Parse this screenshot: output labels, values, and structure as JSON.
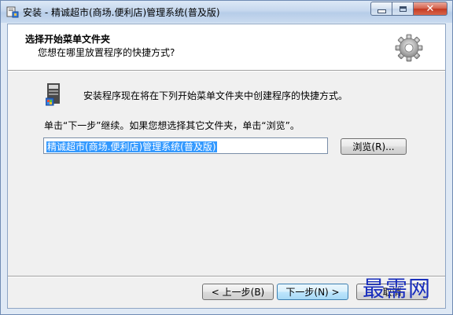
{
  "window": {
    "title": "安装 - 精诚超市(商场.便利店)管理系统(普及版)"
  },
  "header": {
    "title": "选择开始菜单文件夹",
    "subtitle": "您想在哪里放置程序的快捷方式?"
  },
  "body": {
    "info_text": "安装程序现在将在下列开始菜单文件夹中创建程序的快捷方式。",
    "instruction_text": "单击“下一步”继续。如果您想选择其它文件夹，单击“浏览”。",
    "folder_value": "精诚超市(商场.便利店)管理系统(普及版)",
    "browse_label": "浏览(R)..."
  },
  "footer": {
    "back_label": "< 上一步(B)",
    "next_label": "下一步(N) >",
    "cancel_label": "取消"
  },
  "watermark": "最需网",
  "icons": {
    "app": "installer-icon",
    "header": "gear-icon",
    "folder": "program-folder-icon"
  },
  "colors": {
    "selection": "#3399ff",
    "watermark": "#1a2fbd"
  }
}
